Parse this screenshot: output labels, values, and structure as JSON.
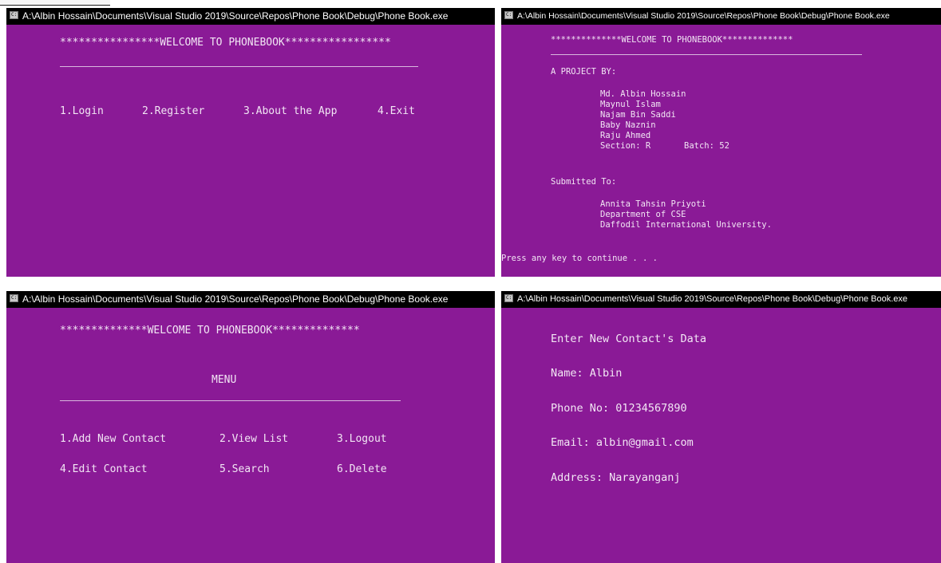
{
  "windows": [
    {
      "title": "A:\\Albin Hossain\\Documents\\Visual Studio 2019\\Source\\Repos\\Phone Book\\Debug\\Phone Book.exe",
      "banner": "****************WELCOME TO PHONEBOOK*****************",
      "options": [
        "1.Login",
        "2.Register",
        "3.About the App",
        "4.Exit"
      ]
    },
    {
      "title": "A:\\Albin Hossain\\Documents\\Visual Studio 2019\\Source\\Repos\\Phone Book\\Debug\\Phone Book.exe",
      "banner": "**************WELCOME TO PHONEBOOK**************",
      "project_by_label": "A PROJECT BY:",
      "members": [
        "Md. Albin Hossain",
        "Maynul Islam",
        "Najam Bin Saddi",
        "Baby Naznin",
        "Raju Ahmed"
      ],
      "section_label": "Section: R",
      "batch_label": "Batch: 52",
      "submitted_to_label": "Submitted To:",
      "submitted_to": [
        "Annita Tahsin Priyoti",
        "Department of CSE",
        "Daffodil International University."
      ],
      "prompt": "Press any key to continue . . ."
    },
    {
      "title": "A:\\Albin Hossain\\Documents\\Visual Studio 2019\\Source\\Repos\\Phone Book\\Debug\\Phone Book.exe",
      "banner": "**************WELCOME TO PHONEBOOK**************",
      "menu_label": "MENU",
      "options": [
        "1.Add New Contact",
        "2.View List",
        "3.Logout",
        "4.Edit Contact",
        "5.Search",
        "6.Delete"
      ]
    },
    {
      "title": "A:\\Albin Hossain\\Documents\\Visual Studio 2019\\Source\\Repos\\Phone Book\\Debug\\Phone Book.exe",
      "heading": "Enter New Contact's Data",
      "fields": [
        "Name: Albin",
        "Phone No: 01234567890",
        "Email: albin@gmail.com",
        "Address: Narayanganj"
      ]
    }
  ],
  "icon": "cmd-console-icon",
  "icon_glyph": "C:\\",
  "colors": {
    "console_bg": "#8a1a96",
    "console_text": "#f2e6f4",
    "titlebar_bg": "#000000"
  }
}
